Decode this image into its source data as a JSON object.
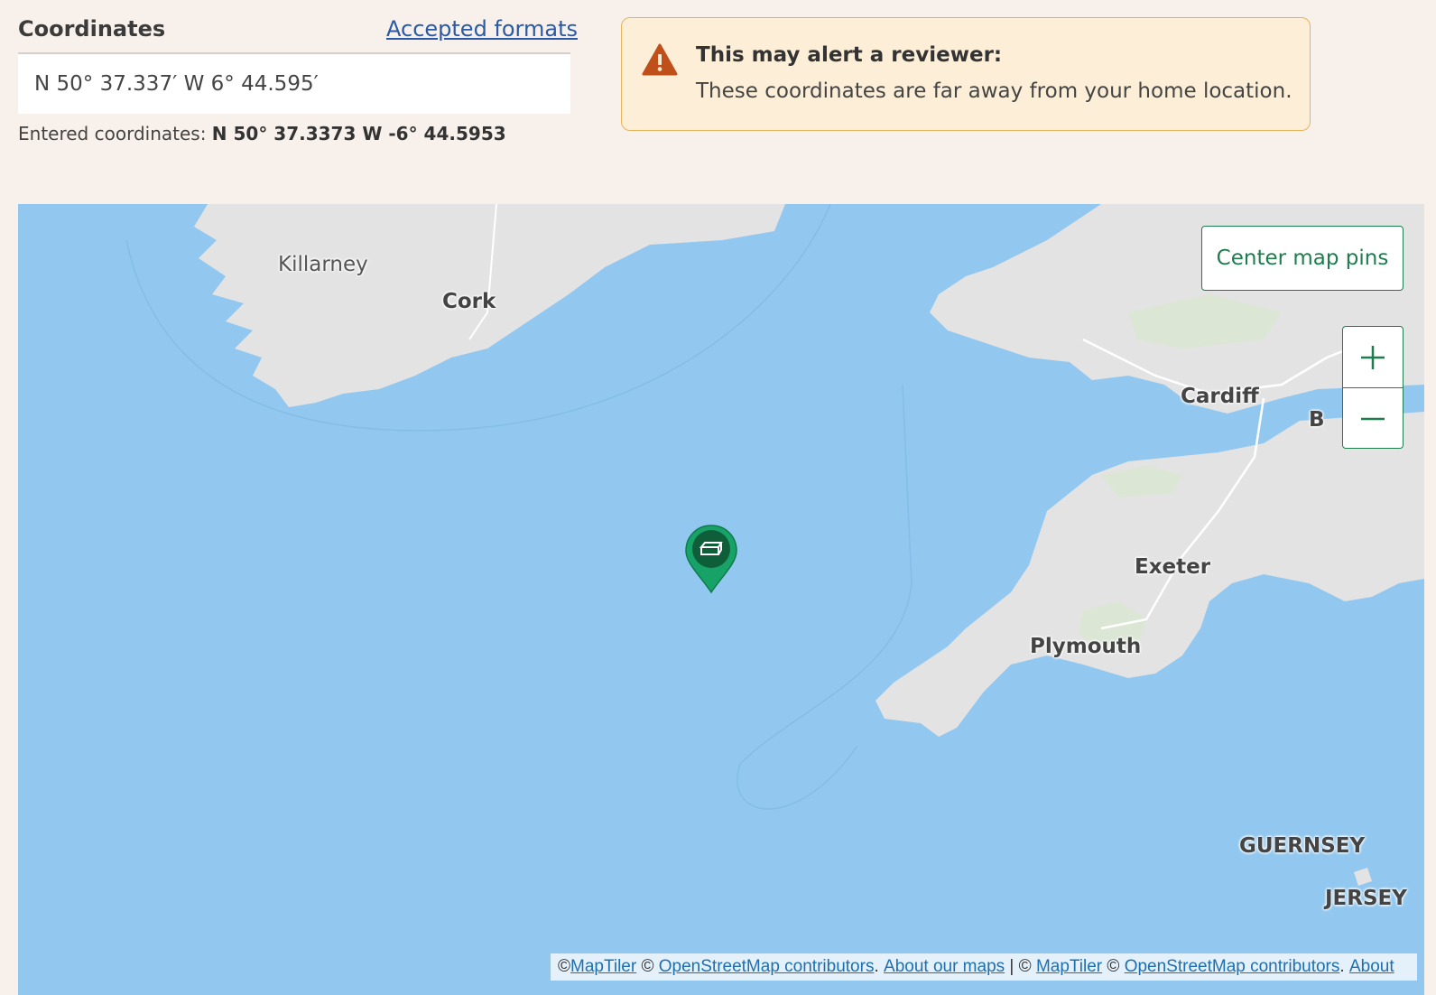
{
  "coordinates": {
    "label": "Coordinates",
    "formats_link": "Accepted formats",
    "input_value": "N 50° 37.337′ W 6° 44.595′",
    "entered_prefix": "Entered coordinates: ",
    "entered_value": "N 50° 37.3373 W -6° 44.5953"
  },
  "alert": {
    "icon": "warning-triangle-icon",
    "title": "This may alert a reviewer:",
    "message": "These coordinates are far away from your home location.",
    "color": "#c0501a"
  },
  "map": {
    "center_button": "Center map pins",
    "zoom_in": "+",
    "zoom_out": "−",
    "pin_icon": "cache-box-icon",
    "pin_color": "#17a368",
    "cities": [
      {
        "name": "Killarney"
      },
      {
        "name": "Cork"
      },
      {
        "name": "Cardiff"
      },
      {
        "name": "B"
      },
      {
        "name": "Exeter"
      },
      {
        "name": "Plymouth"
      },
      {
        "name": "GUERNSEY"
      },
      {
        "name": "JERSEY"
      }
    ],
    "attribution": {
      "c1": "© ",
      "maptiler": "MapTiler",
      "c2": " © ",
      "osm": "OpenStreetMap contributors",
      "sep1": ". ",
      "about_maps": "About our maps",
      "pipe": " | © ",
      "maptiler2": "MapTiler",
      "c3": " © ",
      "osm2": "OpenStreetMap contributors",
      "sep2": ". ",
      "about": "About"
    }
  }
}
